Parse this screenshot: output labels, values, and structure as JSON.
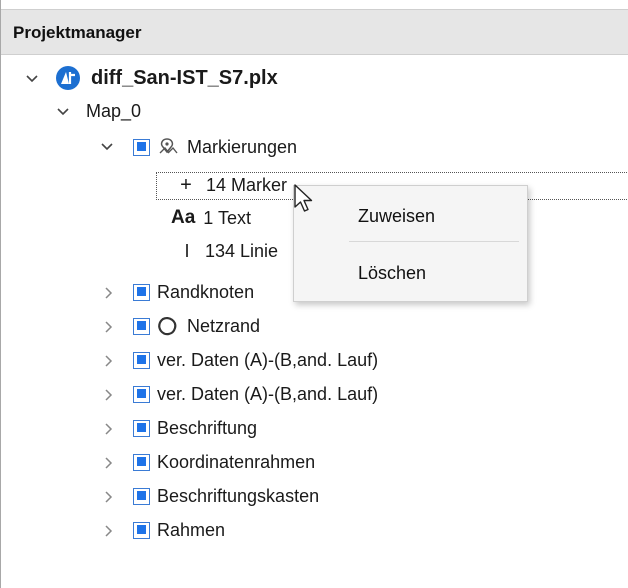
{
  "panel": {
    "title": "Projektmanager"
  },
  "tree": {
    "root": {
      "label": "diff_San-IST_S7.plx",
      "icon": "project-logo-icon"
    },
    "map": {
      "label": "Map_0"
    },
    "markierungen": {
      "label": "Markierungen",
      "icon": "marker-layer-icon"
    },
    "children": {
      "marker": {
        "prefix": "+",
        "label": "14 Marker"
      },
      "text": {
        "prefix": "Aa",
        "label": "1 Text"
      },
      "linien": {
        "prefix": "I",
        "label": "134 Linie"
      }
    },
    "layers": [
      {
        "label": "Randknoten"
      },
      {
        "label": "Netzrand",
        "icon": "netzrand-outline-icon"
      },
      {
        "label": "ver. Daten (A)-(B,and. Lauf)"
      },
      {
        "label": "ver. Daten (A)-(B,and. Lauf)"
      },
      {
        "label": "Beschriftung"
      },
      {
        "label": "Koordinatenrahmen"
      },
      {
        "label": "Beschriftungskasten"
      },
      {
        "label": "Rahmen"
      }
    ]
  },
  "context_menu": {
    "items": [
      {
        "label": "Zuweisen"
      },
      {
        "label": "Löschen"
      }
    ]
  },
  "colors": {
    "checkbox_fill": "#1e73e8",
    "logo_blue": "#1c6fd1",
    "header_bg": "#e6e6e6"
  }
}
